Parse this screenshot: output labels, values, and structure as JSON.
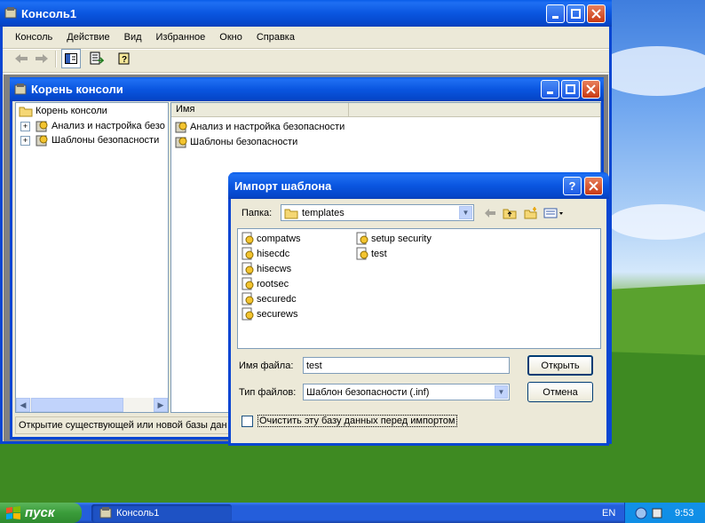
{
  "main_window": {
    "title": "Консоль1",
    "menu": [
      "Консоль",
      "Действие",
      "Вид",
      "Избранное",
      "Окно",
      "Справка"
    ],
    "controls": {
      "minimize": "_",
      "maximize": "□",
      "close": "✕"
    }
  },
  "child_window": {
    "title": "Корень консоли",
    "tree": {
      "root": "Корень консоли",
      "items": [
        "Анализ и настройка безо",
        "Шаблоны безопасности"
      ]
    },
    "list": {
      "column_header": "Имя",
      "items": [
        "Анализ и настройка безопасности",
        "Шаблоны безопасности"
      ]
    },
    "status_text": "Открытие существующей или новой базы дан"
  },
  "dialog": {
    "title": "Импорт шаблона",
    "folder_label": "Папка:",
    "folder_value": "templates",
    "files_col1": [
      "compatws",
      "hisecdc",
      "hisecws",
      "rootsec",
      "securedc",
      "securews"
    ],
    "files_col2": [
      "setup security",
      "test"
    ],
    "filename_label": "Имя файла:",
    "filename_value": "test",
    "filetype_label": "Тип файлов:",
    "filetype_value": "Шаблон безопасности (.inf)",
    "open_button": "Открыть",
    "cancel_button": "Отмена",
    "checkbox_label": "Очистить эту базу данных перед импортом",
    "checkbox_checked": false,
    "help_button": "?"
  },
  "taskbar": {
    "start_label": "пуск",
    "task_label": "Консоль1",
    "language": "EN",
    "clock": "9:53"
  }
}
